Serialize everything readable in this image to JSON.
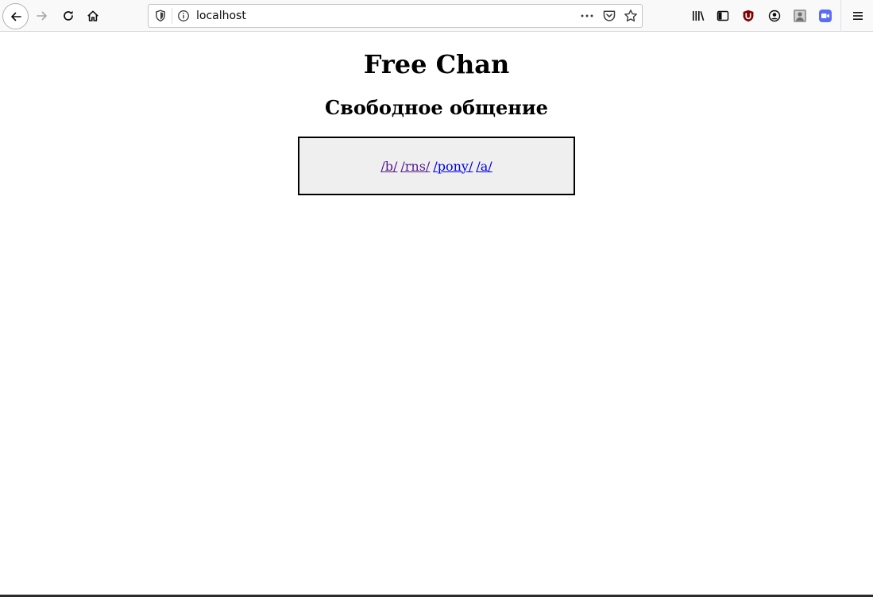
{
  "browser": {
    "url": "localhost",
    "icons": {
      "back": "back-arrow-icon",
      "forward": "forward-arrow-icon",
      "reload": "reload-icon",
      "home": "home-icon",
      "shield": "tracking-protection-shield-icon",
      "info": "site-info-icon",
      "more": "page-actions-more-icon",
      "pocket": "pocket-icon",
      "bookmark": "bookmark-star-icon",
      "library": "library-icon",
      "sidebar": "sidebar-icon",
      "ublock": "ublock-origin-icon",
      "account": "account-icon",
      "extension": "extension-icon",
      "video": "video-extension-icon",
      "menu": "hamburger-menu-icon"
    },
    "colors": {
      "ublock": "#800000",
      "video_ext": "#5b6df6"
    }
  },
  "page": {
    "title": "Free Chan",
    "subtitle": "Свободное общение",
    "boards": [
      {
        "label": "/b/",
        "visited": true
      },
      {
        "label": "/rns/",
        "visited": true
      },
      {
        "label": "/pony/",
        "visited": false
      },
      {
        "label": "/a/",
        "visited": false
      }
    ],
    "colors": {
      "box_background": "#efefef",
      "visited_link": "#551a8b",
      "link": "#0000ee"
    }
  }
}
